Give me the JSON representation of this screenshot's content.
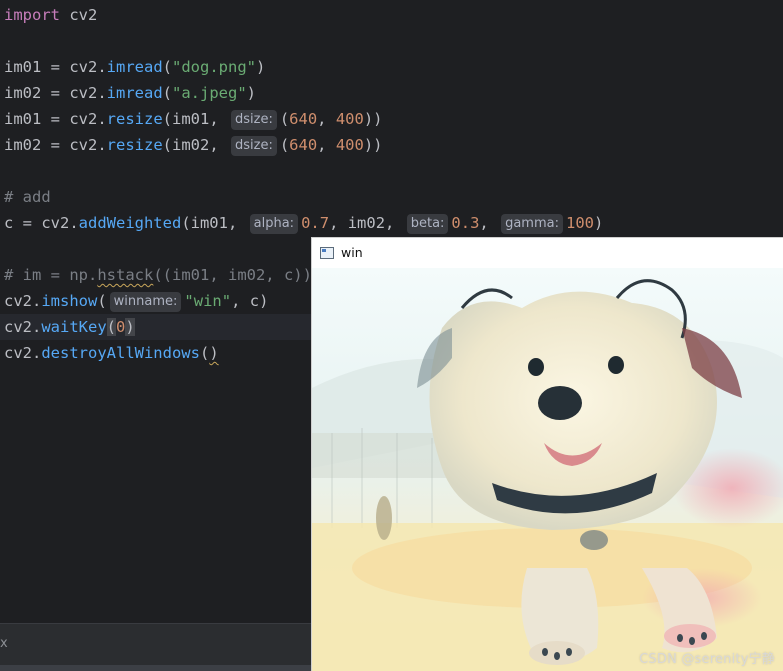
{
  "code": {
    "line1": {
      "kw": "import",
      "rest": " cv2"
    },
    "line3": {
      "a": "im01 = cv2.",
      "fn": "imread",
      "b": "(",
      "str": "\"dog.png\"",
      "c": ")"
    },
    "line4": {
      "a": "im02 = cv2.",
      "fn": "imread",
      "b": "(",
      "str": "\"a.jpeg\"",
      "c": ")"
    },
    "line5": {
      "a": "im01 = cv2.",
      "fn": "resize",
      "b": "(im01, ",
      "hint": "dsize:",
      "c": "(",
      "n1": "640",
      "d": ", ",
      "n2": "400",
      "e": "))"
    },
    "line6": {
      "a": "im02 = cv2.",
      "fn": "resize",
      "b": "(im02, ",
      "hint": "dsize:",
      "c": "(",
      "n1": "640",
      "d": ", ",
      "n2": "400",
      "e": "))"
    },
    "line8": {
      "cmt": "# add"
    },
    "line9": {
      "a": "c = cv2.",
      "fn": "addWeighted",
      "b": "(im01, ",
      "hint1": "alpha:",
      "n1": "0.7",
      "c": ", im02, ",
      "hint2": "beta:",
      "n2": "0.3",
      "d": ", ",
      "hint3": "gamma:",
      "n3": "100",
      "e": ")"
    },
    "line11": {
      "cmt_a": "# im = np.",
      "cmt_fn": "hstack",
      "cmt_b": "((im01, im02, c))"
    },
    "line12": {
      "a": "cv2.",
      "fn": "imshow",
      "b": "(",
      "hint": "winname:",
      "str": "\"win\"",
      "c": ", c)"
    },
    "line13": {
      "a": "cv2.",
      "fn": "waitKey",
      "b": "(",
      "n": "0",
      "c": ")"
    },
    "line14": {
      "a": "cv2.",
      "fn": "destroyAllWindows",
      "b": "(",
      "c": ")"
    }
  },
  "bottom_panel": {
    "close_glyph": "x"
  },
  "cv_window": {
    "title": "win",
    "icon": "window-app-icon",
    "image_description": "blended image"
  },
  "watermark": "CSDN @serenity宁静",
  "colors": {
    "editor_bg": "#1e1f22",
    "keyword": "#c77dbb",
    "function": "#56a8f5",
    "string": "#6aab73",
    "number": "#2aacb8",
    "comment": "#7a7e85",
    "inlay_hint_bg": "#393b40"
  }
}
